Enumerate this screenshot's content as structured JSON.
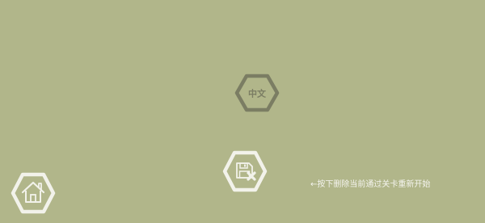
{
  "screen": {
    "background": "#b1b68a"
  },
  "language_button": {
    "label": "中文",
    "icon": "hexagon-outline-icon",
    "color": "#7b7d63"
  },
  "delete_save_button": {
    "icon": "floppy-disk-x-icon",
    "color": "#f2f2ea"
  },
  "home_button": {
    "icon": "house-icon",
    "color": "#f2f2ea"
  },
  "hint": {
    "text": "←按下删除当前通过关卡重新开始",
    "color": "#f4f4ee"
  }
}
